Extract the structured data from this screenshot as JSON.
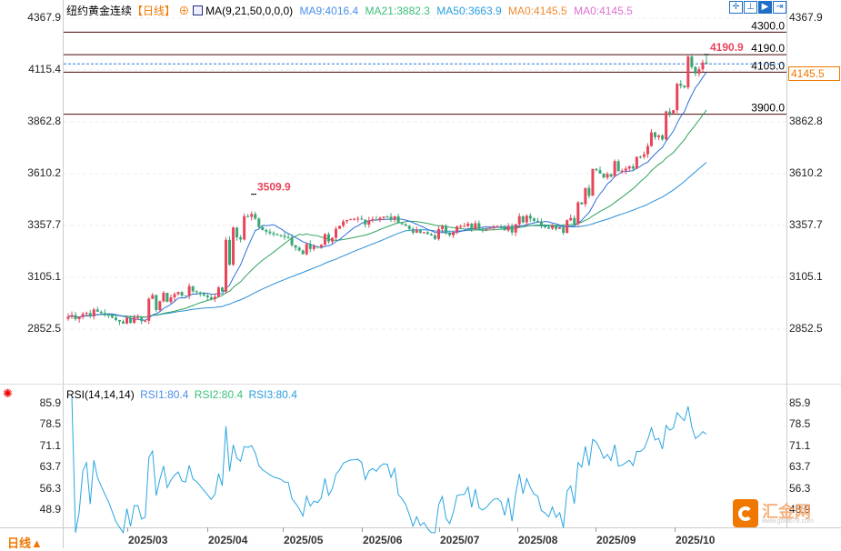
{
  "header": {
    "title": "纽约黄金连续",
    "period": "【日线】",
    "indicator": "MA(9,21,50,0,0,0)",
    "ma9": "MA9:4016.4",
    "ma21": "MA21:3882.3",
    "ma50": "MA50:3663.9",
    "ma0a": "MA0:4145.5",
    "ma0b": "MA0:4145.5"
  },
  "rsi_header": {
    "label": "RSI(14,14,14)",
    "rsi1": "RSI1:80.4",
    "rsi2": "RSI2:80.4",
    "rsi3": "RSI3:80.4"
  },
  "price_axis": [
    "4367.9",
    "4115.4",
    "3862.8",
    "3610.2",
    "3357.7",
    "3105.1",
    "2852.5"
  ],
  "price_axis_right": [
    "4367.9",
    "3862.8",
    "3610.2",
    "3357.7",
    "3105.1",
    "2852.5"
  ],
  "rsi_axis": [
    "85.9",
    "78.5",
    "71.1",
    "63.7",
    "56.3",
    "48.9"
  ],
  "current_price": "4145.5",
  "levels": [
    "4300.0",
    "4190.0",
    "4105.0",
    "3900.0"
  ],
  "annotations": {
    "high": "4190.9",
    "peak": "3509.9"
  },
  "dates": [
    "2025/03",
    "2025/04",
    "2025/05",
    "2025/06",
    "2025/07",
    "2025/08",
    "2025/09",
    "2025/10"
  ],
  "footer": {
    "period_button": "日线▲",
    "logo_text": "汇金网",
    "logo_url_text": "www.gold678.com"
  },
  "colors": {
    "up": "#e8455a",
    "down": "#3aa676",
    "ma9": "#2f6fd8",
    "ma21": "#2ea35a",
    "ma50": "#2a8fd8",
    "rsi": "#2aa5e0",
    "level": "#4a0a0a",
    "accent": "#f07800"
  },
  "chart_data": {
    "type": "candlestick",
    "weekly_closes": [
      2910,
      2930,
      2935,
      2890,
      2910,
      2985,
      3020,
      3040,
      3000,
      3230,
      3420,
      3330,
      3300,
      3220,
      3290,
      3330,
      3380,
      3400,
      3390,
      3330,
      3310,
      3340,
      3350,
      3360,
      3340,
      3420,
      3360,
      3350,
      3440,
      3590,
      3640,
      3660,
      3760,
      3880,
      4080,
      4145.5
    ],
    "ylim": [
      2700,
      4400
    ],
    "rsi_ylim": [
      40,
      90
    ]
  }
}
